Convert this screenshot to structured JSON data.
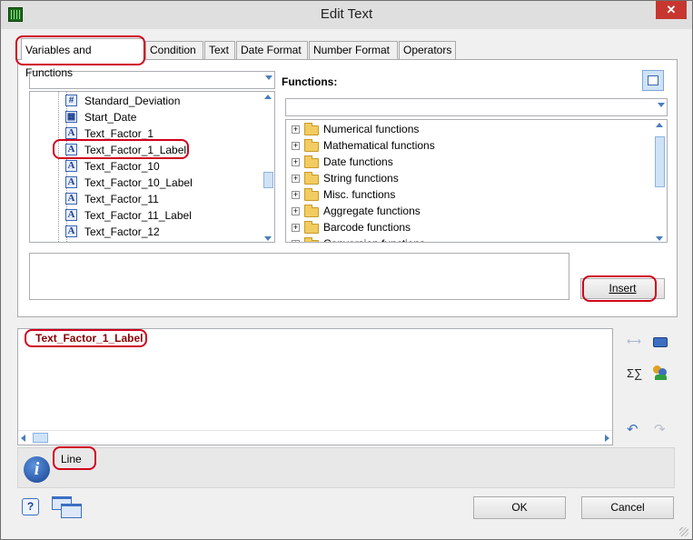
{
  "window": {
    "title": "Edit Text",
    "close_label": "✕"
  },
  "tabs": [
    "Variables and Functions",
    "Condition",
    "Text",
    "Date Format",
    "Number Format",
    "Operators"
  ],
  "variables": {
    "combo_value": "",
    "items": [
      {
        "label": "Standard_Deviation",
        "icon": "#"
      },
      {
        "label": "Start_Date",
        "icon": "▦"
      },
      {
        "label": "Text_Factor_1",
        "icon": "A"
      },
      {
        "label": "Text_Factor_1_Label",
        "icon": "A"
      },
      {
        "label": "Text_Factor_10",
        "icon": "A"
      },
      {
        "label": "Text_Factor_10_Label",
        "icon": "A"
      },
      {
        "label": "Text_Factor_11",
        "icon": "A"
      },
      {
        "label": "Text_Factor_11_Label",
        "icon": "A"
      },
      {
        "label": "Text_Factor_12",
        "icon": "A"
      }
    ]
  },
  "functions": {
    "label": "Functions:",
    "combo_value": "",
    "items": [
      "Numerical functions",
      "Mathematical functions",
      "Date functions",
      "String functions",
      "Misc. functions",
      "Aggregate functions",
      "Barcode functions",
      "Conversion functions"
    ]
  },
  "insert_button": "Insert",
  "editor": {
    "text": "Text_Factor_1_Label"
  },
  "editor_tools": {
    "sum_label": "Σ∑"
  },
  "info": {
    "text": "Line"
  },
  "buttons": {
    "ok": "OK",
    "cancel": "Cancel"
  }
}
